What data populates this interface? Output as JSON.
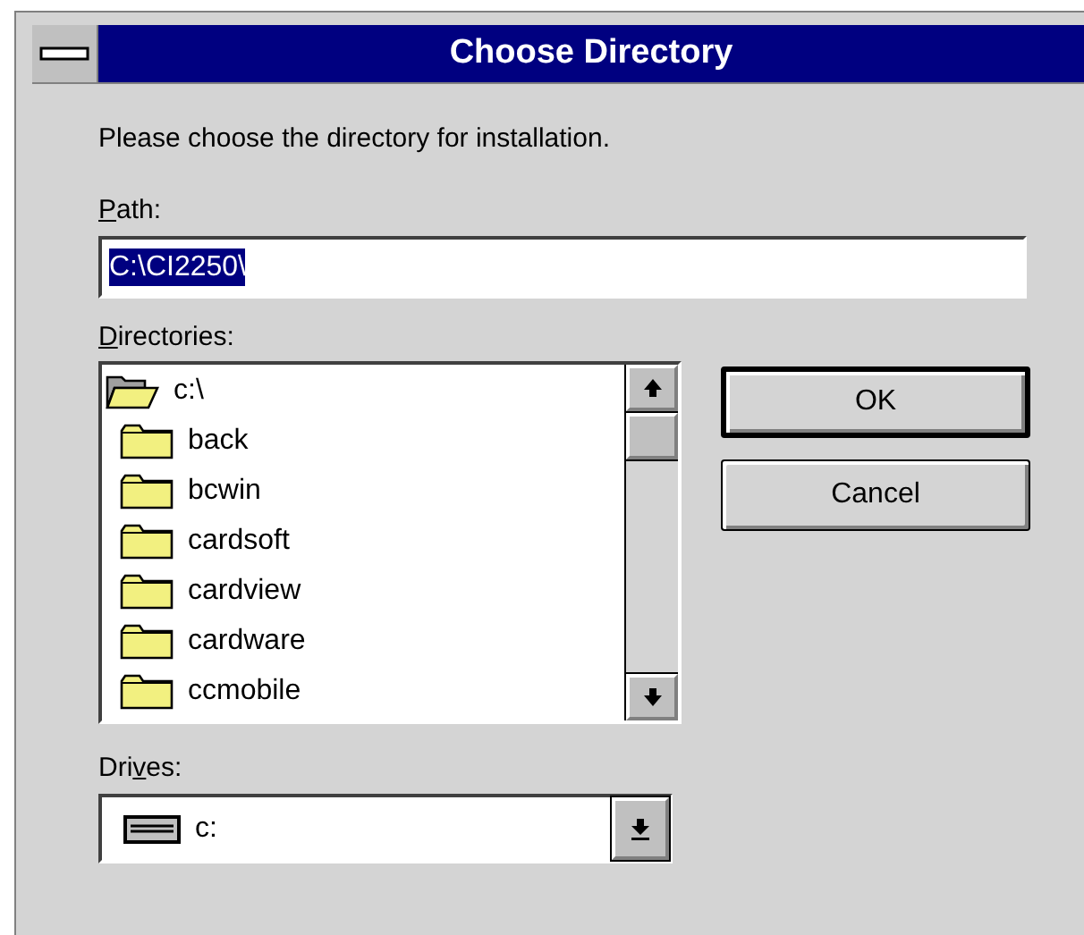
{
  "window": {
    "title": "Choose Directory"
  },
  "prompt": "Please choose the directory for installation.",
  "path": {
    "label": {
      "key": "P",
      "after": "ath:"
    },
    "value": "C:\\CI2250\\",
    "selected": true
  },
  "directories": {
    "label": {
      "key": "D",
      "after": "irectories:"
    },
    "items": [
      {
        "name": "c:\\",
        "expanded": true,
        "children": [
          {
            "name": "back",
            "expanded": false
          },
          {
            "name": "bcwin",
            "expanded": false
          },
          {
            "name": "cardsoft",
            "expanded": false
          },
          {
            "name": "cardview",
            "expanded": false
          },
          {
            "name": "cardware",
            "expanded": false
          },
          {
            "name": "ccmobile",
            "expanded": false
          }
        ]
      }
    ]
  },
  "drives": {
    "label": {
      "before": "Dri",
      "key": "v",
      "after": "es:"
    },
    "value": "c:"
  },
  "buttons": [
    {
      "label": "OK",
      "default": true
    },
    {
      "label": "Cancel",
      "default": false
    }
  ]
}
